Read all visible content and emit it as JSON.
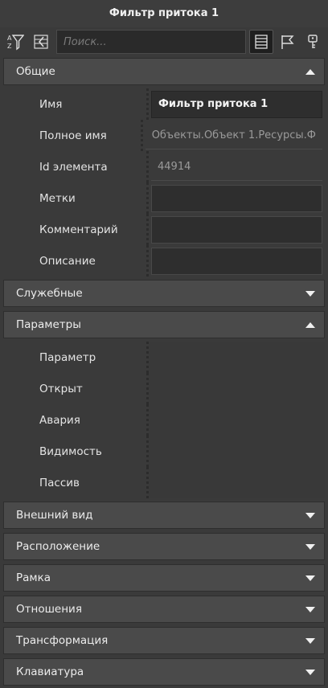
{
  "window": {
    "title": "Фильтр притока 1"
  },
  "toolbar": {
    "search_placeholder": "Поиск...",
    "buttons": [
      "filter-sort-icon",
      "collapse-icon",
      "list-view-icon",
      "flag-icon",
      "key-icon"
    ]
  },
  "sections": {
    "general": {
      "label": "Общие",
      "rows": [
        {
          "name": "Имя",
          "value": "Фильтр притока 1"
        },
        {
          "name": "Полное имя",
          "value": "Объекты.Объект 1.Ресурсы.Ф"
        },
        {
          "name": "Id элемента",
          "value": "44914"
        },
        {
          "name": "Метки",
          "value": ""
        },
        {
          "name": "Комментарий",
          "value": ""
        },
        {
          "name": "Описание",
          "value": ""
        }
      ]
    },
    "service": {
      "label": "Служебные"
    },
    "parameters": {
      "label": "Параметры",
      "rows": [
        {
          "name": "Параметр"
        },
        {
          "name": "Открыт"
        },
        {
          "name": "Авария"
        },
        {
          "name": "Видимость"
        },
        {
          "name": "Пассив"
        }
      ]
    },
    "appearance": {
      "label": "Внешний вид"
    },
    "location": {
      "label": "Расположение"
    },
    "frame": {
      "label": "Рамка"
    },
    "relations": {
      "label": "Отношения"
    },
    "transform": {
      "label": "Трансформация"
    },
    "keyboard": {
      "label": "Клавиатура"
    }
  },
  "colors": {
    "background": "#3a3a3a",
    "header": "#4a4a4a",
    "field": "#2e2e2e",
    "text": "#e8e8e8"
  }
}
